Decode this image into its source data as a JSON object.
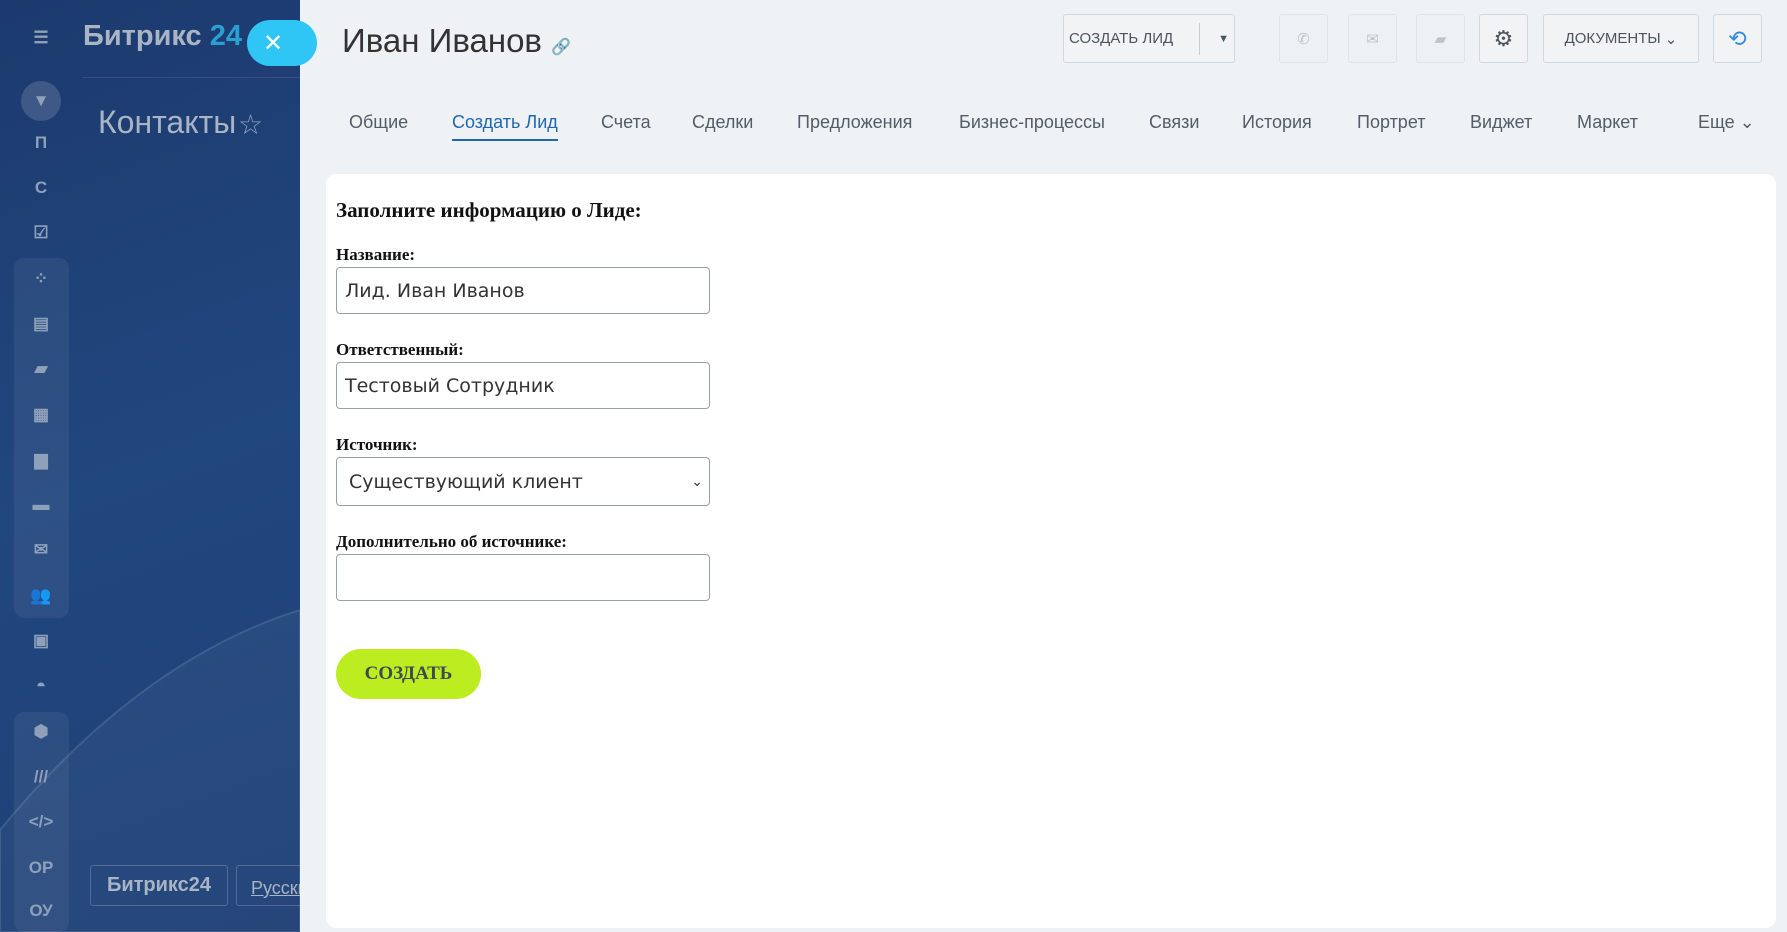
{
  "sidebar": {
    "logo_main": "Битрикс",
    "logo_num": "24",
    "section_title": "Контакты",
    "icon_letters": [
      "П",
      "С",
      "ОР",
      "ОУ"
    ],
    "footer_logo": "Битрикс24",
    "footer_lang": "Русски"
  },
  "header": {
    "title": "Иван Иванов",
    "create_lead": "СОЗДАТЬ ЛИД",
    "documents": "ДОКУМЕНТЫ"
  },
  "tabs": [
    "Общие",
    "Создать Лид",
    "Счета",
    "Сделки",
    "Предложения",
    "Бизнес-процессы",
    "Связи",
    "История",
    "Портрет",
    "Виджет",
    "Маркет",
    "Еще"
  ],
  "form": {
    "heading": "Заполните информацию о Лиде:",
    "name_label": "Название:",
    "name_value": "Лид. Иван Иванов",
    "resp_label": "Ответственный:",
    "resp_value": "Тестовый Сотрудник",
    "source_label": "Источник:",
    "source_value": "Существующий клиент",
    "extra_label": "Дополнительно об источнике:",
    "extra_value": "",
    "submit": "СОЗДАТЬ"
  }
}
